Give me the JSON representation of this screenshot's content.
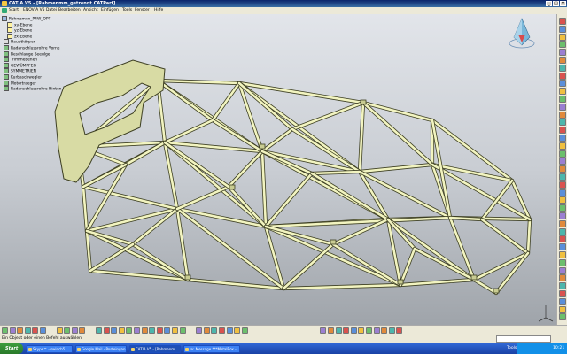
{
  "window": {
    "title": "CATIA V5 - [Rahmenmm_getrennt.CATPart]"
  },
  "menu": [
    "Start",
    "ENOVIA V5",
    "Datei",
    "Bearbeiten",
    "Ansicht",
    "Einfügen",
    "Tools",
    "Fenster",
    "Hilfe"
  ],
  "tree": {
    "items": [
      "Rohrramen_P4W_OPT",
      "xy-Ebene",
      "yz-Ebene",
      "zx-Ebene",
      "Hauptkörper",
      "Radanschlussrohre Vorne",
      "Beschlange Seeulge",
      "Trimmebenen",
      "GEWÜMPFEQ",
      "SYMMETRIEN",
      "Kurbaschwegler",
      "Motortraeger",
      "Radanschlussrohre Hinten"
    ]
  },
  "status": {
    "message": "Ein Objekt oder einen Befehl auswählen"
  },
  "taskbar": {
    "start": "Start",
    "buttons": [
      "Skype™ - swinch5",
      "Google Mail - Posteingan...",
      "CATIA V5 - [Rahmenm...",
      "re: Message ***MetalBox - ..."
    ],
    "tools": "Tools",
    "clock": "10:21"
  },
  "colors": {
    "frame_tube": "#f2f4c0",
    "frame_outline": "#3d3f22",
    "titlebar": "#0a246a"
  }
}
